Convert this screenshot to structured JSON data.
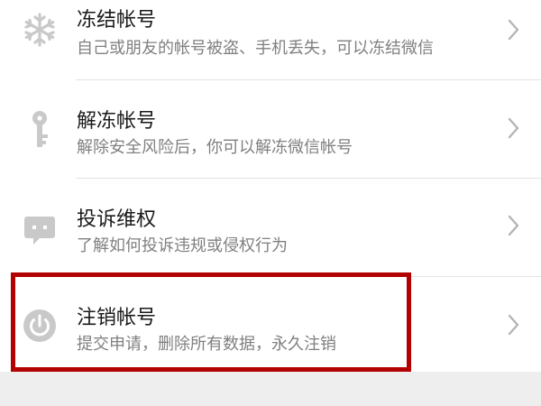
{
  "items": [
    {
      "id": "freeze",
      "icon": "snowflake-icon",
      "title": "冻结帐号",
      "subtitle": "自己或朋友的帐号被盗、手机丢失，可以冻结微信"
    },
    {
      "id": "unfreeze",
      "icon": "key-icon",
      "title": "解冻帐号",
      "subtitle": "解除安全风险后，你可以解冻微信帐号"
    },
    {
      "id": "complain",
      "icon": "chat-bubble-icon",
      "title": "投诉维权",
      "subtitle": "了解如何投诉违规或侵权行为"
    },
    {
      "id": "cancel",
      "icon": "power-icon",
      "title": "注销帐号",
      "subtitle": "提交申请，删除所有数据，永久注销"
    }
  ],
  "colors": {
    "icon_gray": "#c9c9c9",
    "highlight": "#b30000",
    "title_text": "#1a1a1a",
    "subtitle_text": "#808080",
    "background_gray": "#eeeeee"
  }
}
